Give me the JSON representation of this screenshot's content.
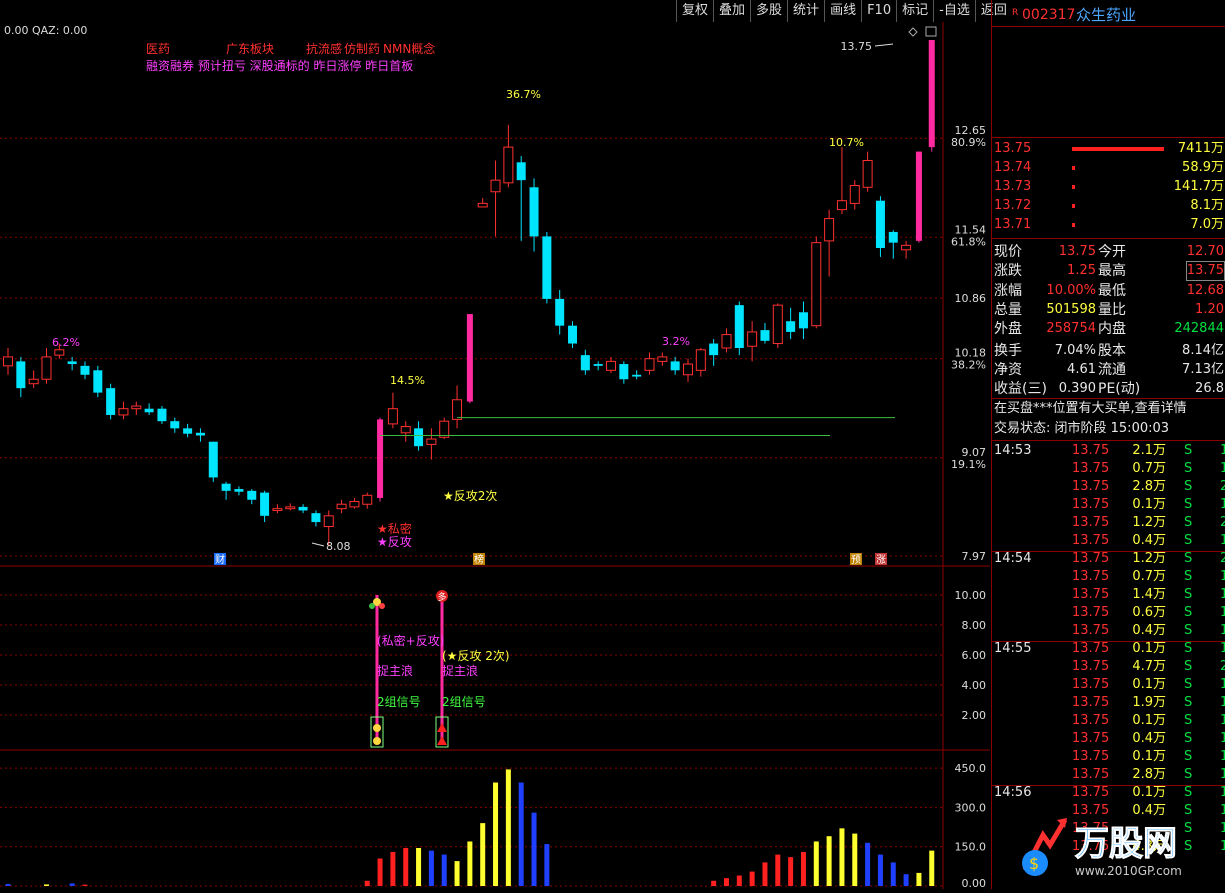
{
  "toolbar": {
    "buttons": [
      "复权",
      "叠加",
      "多股",
      "统计",
      "画线",
      "F10",
      "标记",
      "-自选",
      "返回"
    ]
  },
  "main": {
    "indicator_label": "0.00  QAZ: 0.00",
    "tags_line1": [
      "医药",
      "广东板块",
      "抗流感",
      "仿制药",
      "NMN概念"
    ],
    "tags_line2": "融资融券 预计扭亏 深股通标的 昨日涨停 昨日首板",
    "price_axis": [
      "12.65",
      "80.9%",
      "11.54",
      "61.8%",
      "10.86",
      "10.18",
      "38.2%",
      "9.07",
      "19.1%",
      "7.97"
    ],
    "annotations": {
      "high_label": "13.75",
      "low_label": "8.08",
      "pct_a": "6.2%",
      "pct_b": "14.5%",
      "pct_c": "36.7%",
      "pct_d": "3.2%",
      "pct_e": "10.7%",
      "signal_private": "★私密",
      "signal_counter": "★反攻",
      "signal_counter2": "★反攻2次",
      "badge_cai": "财",
      "badge_bang": "榜",
      "badge_yu": "预",
      "badge_zhang": "涨"
    },
    "sub_axis": [
      "10.00",
      "8.00",
      "6.00",
      "4.00",
      "2.00"
    ],
    "sub_annotations": {
      "sig1_line1": "(私密+反攻)",
      "sig1_line2": "捉主浪",
      "sig1_line3": "2组信号",
      "sig2_line1": "(★反攻 2次)",
      "sig2_line2": "捉主浪",
      "sig2_line3": "2组信号",
      "duo": "多"
    },
    "vol_axis": [
      "450.0",
      "300.0",
      "150.0",
      "0.00"
    ]
  },
  "stock": {
    "code": "002317",
    "name": "众生药业",
    "flag": "R"
  },
  "order_book": [
    {
      "price": "13.75",
      "vol": "7411万"
    },
    {
      "price": "13.74",
      "vol": "58.9万"
    },
    {
      "price": "13.73",
      "vol": "141.7万"
    },
    {
      "price": "13.72",
      "vol": "8.1万"
    },
    {
      "price": "13.71",
      "vol": "7.0万"
    }
  ],
  "quote": [
    {
      "l1": "现价",
      "v1": "13.75",
      "l2": "今开",
      "v2": "12.70"
    },
    {
      "l1": "涨跌",
      "v1": "1.25",
      "l2": "最高",
      "v2": "13.75"
    },
    {
      "l1": "涨幅",
      "v1": "10.00%",
      "l2": "最低",
      "v2": "12.68"
    },
    {
      "l1": "总量",
      "v1": "501598",
      "l2": "量比",
      "v2": "1.20"
    },
    {
      "l1": "外盘",
      "v1": "258754",
      "l2": "内盘",
      "v2": "242844"
    },
    {
      "l1": "换手",
      "v1": "7.04%",
      "l2": "股本",
      "v2": "8.14亿"
    },
    {
      "l1": "净资",
      "v1": "4.61",
      "l2": "流通",
      "v2": "7.13亿"
    },
    {
      "l1": "收益(三)",
      "v1": "0.390",
      "l2": "PE(动)",
      "v2": "26.8"
    }
  ],
  "notice": "在买盘***位置有大买单,查看详情",
  "trade_status": "交易状态: 闭市阶段 15:00:03",
  "ticks": [
    {
      "t": "14:53",
      "p": "13.75",
      "v": "2.1万",
      "s": "S",
      "n": "1"
    },
    {
      "t": "",
      "p": "13.75",
      "v": "0.7万",
      "s": "S",
      "n": "1"
    },
    {
      "t": "",
      "p": "13.75",
      "v": "2.8万",
      "s": "S",
      "n": "2"
    },
    {
      "t": "",
      "p": "13.75",
      "v": "0.1万",
      "s": "S",
      "n": "1"
    },
    {
      "t": "",
      "p": "13.75",
      "v": "1.2万",
      "s": "S",
      "n": "2"
    },
    {
      "t": "",
      "p": "13.75",
      "v": "0.4万",
      "s": "S",
      "n": "1"
    },
    {
      "t": "14:54",
      "p": "13.75",
      "v": "1.2万",
      "s": "S",
      "n": "2"
    },
    {
      "t": "",
      "p": "13.75",
      "v": "0.7万",
      "s": "S",
      "n": "1"
    },
    {
      "t": "",
      "p": "13.75",
      "v": "1.4万",
      "s": "S",
      "n": "1"
    },
    {
      "t": "",
      "p": "13.75",
      "v": "0.6万",
      "s": "S",
      "n": "1"
    },
    {
      "t": "",
      "p": "13.75",
      "v": "0.4万",
      "s": "S",
      "n": "1"
    },
    {
      "t": "14:55",
      "p": "13.75",
      "v": "0.1万",
      "s": "S",
      "n": "1"
    },
    {
      "t": "",
      "p": "13.75",
      "v": "4.7万",
      "s": "S",
      "n": "2"
    },
    {
      "t": "",
      "p": "13.75",
      "v": "0.1万",
      "s": "S",
      "n": "1"
    },
    {
      "t": "",
      "p": "13.75",
      "v": "1.9万",
      "s": "S",
      "n": "1"
    },
    {
      "t": "",
      "p": "13.75",
      "v": "0.1万",
      "s": "S",
      "n": "1"
    },
    {
      "t": "",
      "p": "13.75",
      "v": "0.4万",
      "s": "S",
      "n": "1"
    },
    {
      "t": "",
      "p": "13.75",
      "v": "0.1万",
      "s": "S",
      "n": "1"
    },
    {
      "t": "",
      "p": "13.75",
      "v": "2.8万",
      "s": "S",
      "n": "1"
    },
    {
      "t": "14:56",
      "p": "13.75",
      "v": "0.1万",
      "s": "S",
      "n": "1"
    },
    {
      "t": "",
      "p": "13.75",
      "v": "0.4万",
      "s": "S",
      "n": "1"
    },
    {
      "t": "",
      "p": "13.75",
      "v": "",
      "s": "S",
      "n": "1"
    },
    {
      "t": "",
      "p": "13.75",
      "v": "4.3万",
      "s": "S",
      "n": "1"
    }
  ],
  "watermark": {
    "text": "万股网",
    "url": "www.2010GP.com"
  },
  "colors": {
    "up": "#ff3030",
    "down": "#00e5ff",
    "limit_up": "#ff2aa0",
    "grid": "#8b0000"
  },
  "chart_data": {
    "type": "candlestick",
    "title": "",
    "candles": [
      {
        "o": 10.1,
        "c": 10.2,
        "h": 10.3,
        "l": 10.0
      },
      {
        "o": 10.15,
        "c": 9.85,
        "h": 10.2,
        "l": 9.75
      },
      {
        "o": 9.9,
        "c": 9.95,
        "h": 10.05,
        "l": 9.85
      },
      {
        "o": 9.95,
        "c": 10.2,
        "h": 10.3,
        "l": 9.9
      },
      {
        "o": 10.22,
        "c": 10.28,
        "h": 10.35,
        "l": 10.18
      },
      {
        "o": 10.15,
        "c": 10.12,
        "h": 10.2,
        "l": 10.05
      },
      {
        "o": 10.1,
        "c": 10.0,
        "h": 10.15,
        "l": 9.95
      },
      {
        "o": 10.05,
        "c": 9.8,
        "h": 10.1,
        "l": 9.75
      },
      {
        "o": 9.85,
        "c": 9.55,
        "h": 9.9,
        "l": 9.5
      },
      {
        "o": 9.55,
        "c": 9.62,
        "h": 9.7,
        "l": 9.5
      },
      {
        "o": 9.62,
        "c": 9.65,
        "h": 9.7,
        "l": 9.55
      },
      {
        "o": 9.62,
        "c": 9.58,
        "h": 9.68,
        "l": 9.55
      },
      {
        "o": 9.62,
        "c": 9.48,
        "h": 9.65,
        "l": 9.45
      },
      {
        "o": 9.48,
        "c": 9.4,
        "h": 9.52,
        "l": 9.35
      },
      {
        "o": 9.4,
        "c": 9.34,
        "h": 9.45,
        "l": 9.3
      },
      {
        "o": 9.35,
        "c": 9.32,
        "h": 9.4,
        "l": 9.25
      },
      {
        "o": 9.25,
        "c": 8.85,
        "h": 9.25,
        "l": 8.8
      },
      {
        "o": 8.78,
        "c": 8.7,
        "h": 8.8,
        "l": 8.6
      },
      {
        "o": 8.72,
        "c": 8.69,
        "h": 8.75,
        "l": 8.65
      },
      {
        "o": 8.7,
        "c": 8.6,
        "h": 8.72,
        "l": 8.55
      },
      {
        "o": 8.68,
        "c": 8.42,
        "h": 8.7,
        "l": 8.35
      },
      {
        "o": 8.48,
        "c": 8.5,
        "h": 8.55,
        "l": 8.45
      },
      {
        "o": 8.5,
        "c": 8.52,
        "h": 8.56,
        "l": 8.48
      },
      {
        "o": 8.52,
        "c": 8.48,
        "h": 8.55,
        "l": 8.45
      },
      {
        "o": 8.45,
        "c": 8.35,
        "h": 8.48,
        "l": 8.3
      },
      {
        "o": 8.3,
        "c": 8.42,
        "h": 8.48,
        "l": 8.08
      },
      {
        "o": 8.5,
        "c": 8.55,
        "h": 8.6,
        "l": 8.45
      },
      {
        "o": 8.52,
        "c": 8.58,
        "h": 8.62,
        "l": 8.5
      },
      {
        "o": 8.55,
        "c": 8.65,
        "h": 8.68,
        "l": 8.5
      },
      {
        "o": 8.62,
        "c": 9.5,
        "h": 9.52,
        "l": 8.58
      },
      {
        "o": 9.45,
        "c": 9.62,
        "h": 9.8,
        "l": 9.4
      },
      {
        "o": 9.35,
        "c": 9.42,
        "h": 9.48,
        "l": 9.25
      },
      {
        "o": 9.4,
        "c": 9.2,
        "h": 9.48,
        "l": 9.15
      },
      {
        "o": 9.22,
        "c": 9.28,
        "h": 9.4,
        "l": 9.05
      },
      {
        "o": 9.3,
        "c": 9.48,
        "h": 9.52,
        "l": 9.28
      },
      {
        "o": 9.5,
        "c": 9.72,
        "h": 9.88,
        "l": 9.4
      },
      {
        "o": 9.7,
        "c": 10.68,
        "h": 10.68,
        "l": 9.68
      },
      {
        "o": 11.88,
        "c": 11.92,
        "h": 11.98,
        "l": 11.88
      },
      {
        "o": 12.05,
        "c": 12.18,
        "h": 12.4,
        "l": 11.55
      },
      {
        "o": 12.15,
        "c": 12.55,
        "h": 12.8,
        "l": 12.1
      },
      {
        "o": 12.38,
        "c": 12.18,
        "h": 12.45,
        "l": 11.5
      },
      {
        "o": 12.1,
        "c": 11.55,
        "h": 12.2,
        "l": 11.38
      },
      {
        "o": 11.55,
        "c": 10.85,
        "h": 11.6,
        "l": 10.8
      },
      {
        "o": 10.85,
        "c": 10.55,
        "h": 10.95,
        "l": 10.45
      },
      {
        "o": 10.55,
        "c": 10.35,
        "h": 10.6,
        "l": 10.3
      },
      {
        "o": 10.22,
        "c": 10.05,
        "h": 10.28,
        "l": 10.0
      },
      {
        "o": 10.12,
        "c": 10.1,
        "h": 10.15,
        "l": 10.05
      },
      {
        "o": 10.05,
        "c": 10.15,
        "h": 10.2,
        "l": 10.02
      },
      {
        "o": 10.12,
        "c": 9.95,
        "h": 10.15,
        "l": 9.9
      },
      {
        "o": 10.0,
        "c": 9.98,
        "h": 10.05,
        "l": 9.95
      },
      {
        "o": 10.05,
        "c": 10.18,
        "h": 10.25,
        "l": 10.0
      },
      {
        "o": 10.15,
        "c": 10.2,
        "h": 10.25,
        "l": 10.1
      },
      {
        "o": 10.15,
        "c": 10.05,
        "h": 10.2,
        "l": 10.0
      },
      {
        "o": 10.0,
        "c": 10.12,
        "h": 10.18,
        "l": 9.92
      },
      {
        "o": 10.05,
        "c": 10.28,
        "h": 10.3,
        "l": 9.98
      },
      {
        "o": 10.35,
        "c": 10.22,
        "h": 10.4,
        "l": 10.1
      },
      {
        "o": 10.3,
        "c": 10.45,
        "h": 10.52,
        "l": 10.25
      },
      {
        "o": 10.78,
        "c": 10.3,
        "h": 10.82,
        "l": 10.22
      },
      {
        "o": 10.32,
        "c": 10.48,
        "h": 10.6,
        "l": 10.15
      },
      {
        "o": 10.5,
        "c": 10.38,
        "h": 10.58,
        "l": 10.35
      },
      {
        "o": 10.35,
        "c": 10.78,
        "h": 10.8,
        "l": 10.3
      },
      {
        "o": 10.6,
        "c": 10.48,
        "h": 10.75,
        "l": 10.4
      },
      {
        "o": 10.7,
        "c": 10.52,
        "h": 10.82,
        "l": 10.4
      },
      {
        "o": 10.55,
        "c": 11.48,
        "h": 11.55,
        "l": 10.52
      },
      {
        "o": 11.5,
        "c": 11.75,
        "h": 11.85,
        "l": 11.1
      },
      {
        "o": 11.85,
        "c": 11.95,
        "h": 12.55,
        "l": 11.8
      },
      {
        "o": 11.92,
        "c": 12.12,
        "h": 12.18,
        "l": 11.85
      },
      {
        "o": 12.1,
        "c": 12.4,
        "h": 12.5,
        "l": 12.05
      },
      {
        "o": 11.95,
        "c": 11.42,
        "h": 12.0,
        "l": 11.32
      },
      {
        "o": 11.6,
        "c": 11.48,
        "h": 11.62,
        "l": 11.3
      },
      {
        "o": 11.4,
        "c": 11.45,
        "h": 11.5,
        "l": 11.3
      },
      {
        "o": 11.5,
        "c": 12.5,
        "h": 12.5,
        "l": 11.48
      },
      {
        "o": 12.55,
        "c": 13.75,
        "h": 13.75,
        "l": 12.5
      }
    ],
    "limit_up_indices": [
      29,
      36,
      71,
      72
    ],
    "price_ylim": [
      7.97,
      13.75
    ],
    "signal_values": [
      {
        "index": 29,
        "value": 10
      },
      {
        "index": 34,
        "value": 10
      }
    ],
    "signal_ylim": [
      0,
      11
    ],
    "volume": [
      {
        "i": 0,
        "v": 8,
        "c": "blue"
      },
      {
        "i": 3,
        "v": 6,
        "c": "yellow"
      },
      {
        "i": 5,
        "v": 10,
        "c": "blue"
      },
      {
        "i": 6,
        "v": 5,
        "c": "red"
      },
      {
        "i": 28,
        "v": 20,
        "c": "red"
      },
      {
        "i": 29,
        "v": 105,
        "c": "red"
      },
      {
        "i": 30,
        "v": 130,
        "c": "red"
      },
      {
        "i": 31,
        "v": 145,
        "c": "red"
      },
      {
        "i": 32,
        "v": 145,
        "c": "yellow"
      },
      {
        "i": 33,
        "v": 135,
        "c": "blue"
      },
      {
        "i": 34,
        "v": 120,
        "c": "blue"
      },
      {
        "i": 35,
        "v": 95,
        "c": "yellow"
      },
      {
        "i": 36,
        "v": 170,
        "c": "yellow"
      },
      {
        "i": 37,
        "v": 240,
        "c": "yellow"
      },
      {
        "i": 38,
        "v": 395,
        "c": "yellow"
      },
      {
        "i": 39,
        "v": 445,
        "c": "yellow"
      },
      {
        "i": 40,
        "v": 395,
        "c": "blue"
      },
      {
        "i": 41,
        "v": 280,
        "c": "blue"
      },
      {
        "i": 42,
        "v": 160,
        "c": "blue"
      },
      {
        "i": 55,
        "v": 20,
        "c": "red"
      },
      {
        "i": 56,
        "v": 30,
        "c": "red"
      },
      {
        "i": 57,
        "v": 40,
        "c": "red"
      },
      {
        "i": 58,
        "v": 55,
        "c": "red"
      },
      {
        "i": 59,
        "v": 90,
        "c": "red"
      },
      {
        "i": 60,
        "v": 120,
        "c": "red"
      },
      {
        "i": 61,
        "v": 110,
        "c": "red"
      },
      {
        "i": 62,
        "v": 130,
        "c": "red"
      },
      {
        "i": 63,
        "v": 170,
        "c": "yellow"
      },
      {
        "i": 64,
        "v": 190,
        "c": "yellow"
      },
      {
        "i": 65,
        "v": 220,
        "c": "yellow"
      },
      {
        "i": 66,
        "v": 200,
        "c": "yellow"
      },
      {
        "i": 67,
        "v": 165,
        "c": "blue"
      },
      {
        "i": 68,
        "v": 120,
        "c": "blue"
      },
      {
        "i": 69,
        "v": 90,
        "c": "blue"
      },
      {
        "i": 70,
        "v": 45,
        "c": "blue"
      },
      {
        "i": 71,
        "v": 50,
        "c": "yellow"
      },
      {
        "i": 72,
        "v": 135,
        "c": "yellow"
      }
    ],
    "volume_ylim": [
      0,
      500
    ]
  }
}
